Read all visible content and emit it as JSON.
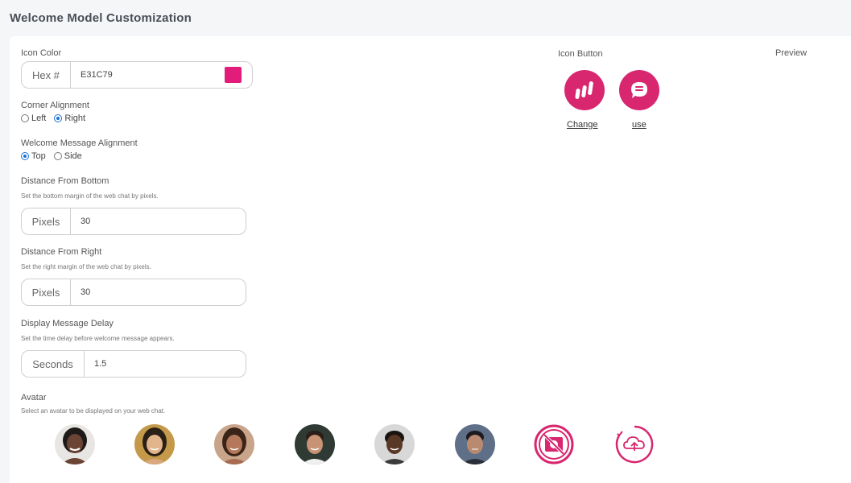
{
  "page": {
    "title": "Welcome Model Customization"
  },
  "icon_color": {
    "label": "Icon Color",
    "prefix": "Hex #",
    "value": "E31C79",
    "swatch": "#E31C79"
  },
  "corner_alignment": {
    "label": "Corner Alignment",
    "options": [
      "Left",
      "Right"
    ],
    "selected": "Right"
  },
  "welcome_alignment": {
    "label": "Welcome Message Alignment",
    "options": [
      "Top",
      "Side"
    ],
    "selected": "Top"
  },
  "distance_bottom": {
    "label": "Distance From Bottom",
    "hint": "Set the bottom margin of the web chat by pixels.",
    "prefix": "Pixels",
    "value": "30"
  },
  "distance_right": {
    "label": "Distance From Right",
    "hint": "Set the right margin of the web chat by pixels.",
    "prefix": "Pixels",
    "value": "30"
  },
  "display_delay": {
    "label": "Display Message Delay",
    "hint": "Set the time delay before welcome message appears.",
    "prefix": "Seconds",
    "value": "1.5"
  },
  "avatar": {
    "label": "Avatar",
    "hint": "Select an avatar to be displayed on your web chat."
  },
  "icon_button": {
    "label": "Icon Button",
    "change_label": "Change",
    "use_label": "use",
    "accent": "#d8266f"
  },
  "preview": {
    "label": "Preview"
  },
  "avatars": [
    {
      "name": "avatar-1",
      "icon": "person-photo"
    },
    {
      "name": "avatar-2",
      "icon": "person-photo"
    },
    {
      "name": "avatar-3",
      "icon": "person-photo"
    },
    {
      "name": "avatar-4",
      "icon": "person-photo"
    },
    {
      "name": "avatar-5",
      "icon": "person-photo"
    },
    {
      "name": "avatar-6",
      "icon": "person-photo"
    },
    {
      "name": "no-avatar",
      "icon": "no-image-icon"
    },
    {
      "name": "upload-avatar",
      "icon": "cloud-upload-icon"
    }
  ]
}
